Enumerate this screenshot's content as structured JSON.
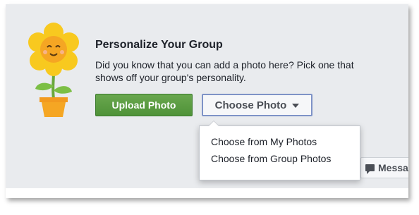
{
  "prompt": {
    "title": "Personalize Your Group",
    "description": "Did you know that you can add a photo here? Pick one that shows off your group's personality."
  },
  "buttons": {
    "upload_label": "Upload Photo",
    "choose_label": "Choose Photo",
    "message_label": "Messa"
  },
  "dropdown": {
    "items": [
      {
        "label": "Choose from My Photos"
      },
      {
        "label": "Choose from Group Photos"
      }
    ]
  },
  "icons": {
    "mascot": "flower-pot-icon",
    "caret": "chevron-down-icon",
    "message": "message-icon"
  },
  "colors": {
    "background": "#e9ebee",
    "upload_green": "#5a9e41",
    "choose_border": "#7e93c7",
    "petal_yellow": "#f8c91f",
    "pot_orange": "#f5a623"
  }
}
